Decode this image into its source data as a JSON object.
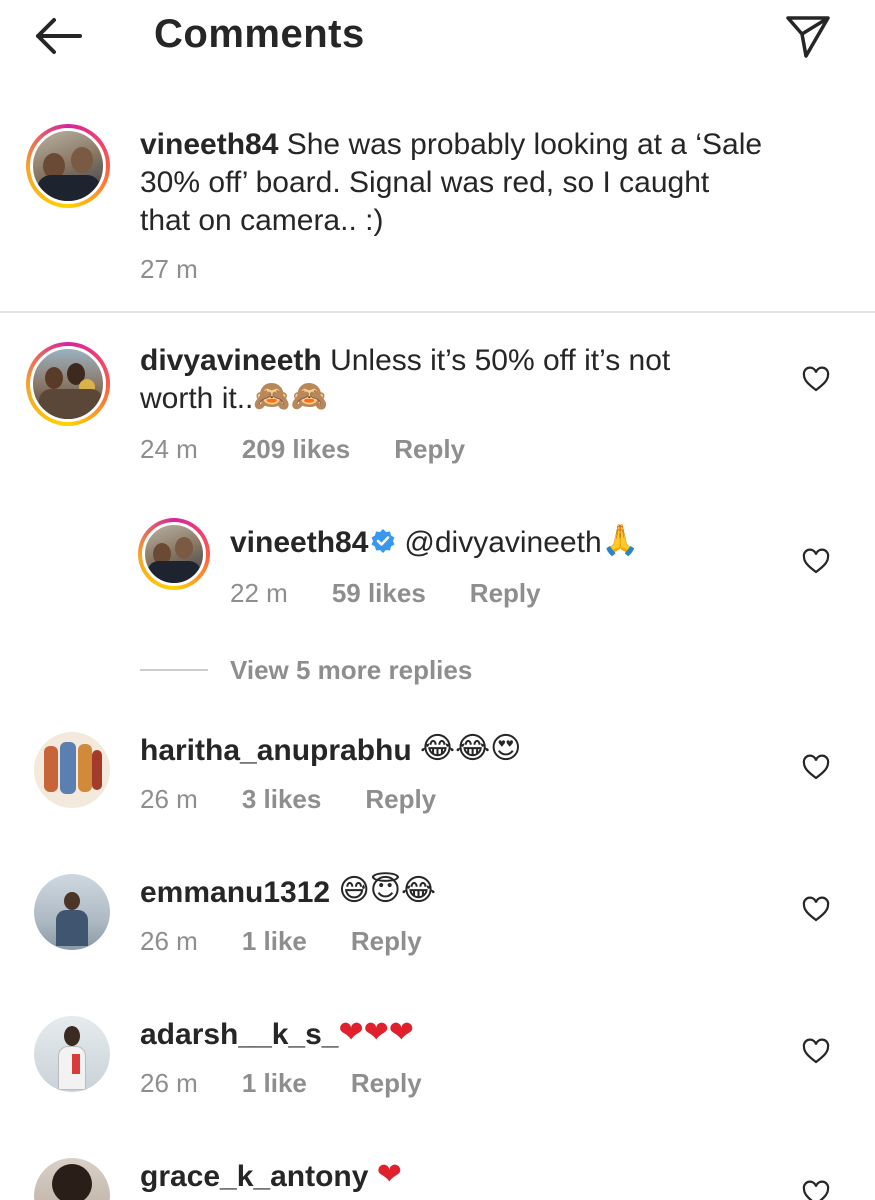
{
  "header": {
    "title": "Comments",
    "back_icon": "arrow-left-icon",
    "send_icon": "paper-plane-icon"
  },
  "caption": {
    "username": "vineeth84",
    "text_line1": " She was probably looking at a ‘Sale",
    "text_line2": "30% off’ board. Signal was red, so I caught",
    "text_line3": "that on camera.. :)",
    "time": "27 m"
  },
  "comments": [
    {
      "username": "divyavineeth",
      "text_line1": " Unless it’s 50% off it’s not",
      "text_line2": "worth it..",
      "emoji": "🙈🙈",
      "time": "24 m",
      "likes": "209 likes",
      "reply": "Reply"
    },
    {
      "username": "vineeth84",
      "mention": "@divyavineeth",
      "emoji": "🙏",
      "time": "22 m",
      "likes": "59 likes",
      "reply": "Reply",
      "verified": true
    },
    {
      "username": "haritha_anuprabhu",
      "emoji": "😂😂😍",
      "time": "26 m",
      "likes": "3 likes",
      "reply": "Reply"
    },
    {
      "username": "emmanu1312",
      "emoji": "😅😇😂",
      "time": "26 m",
      "likes": "1 like",
      "reply": "Reply"
    },
    {
      "username": "adarsh__k_s_",
      "emoji": "❤❤❤",
      "time": "26 m",
      "likes": "1 like",
      "reply": "Reply"
    },
    {
      "username": "grace_k_antony",
      "emoji": "❤"
    }
  ],
  "view_more_replies": "View 5 more replies",
  "colors": {
    "text": "#262626",
    "secondary": "#8e8e8e",
    "verified": "#3897f0",
    "divider": "#e4e4e4"
  }
}
